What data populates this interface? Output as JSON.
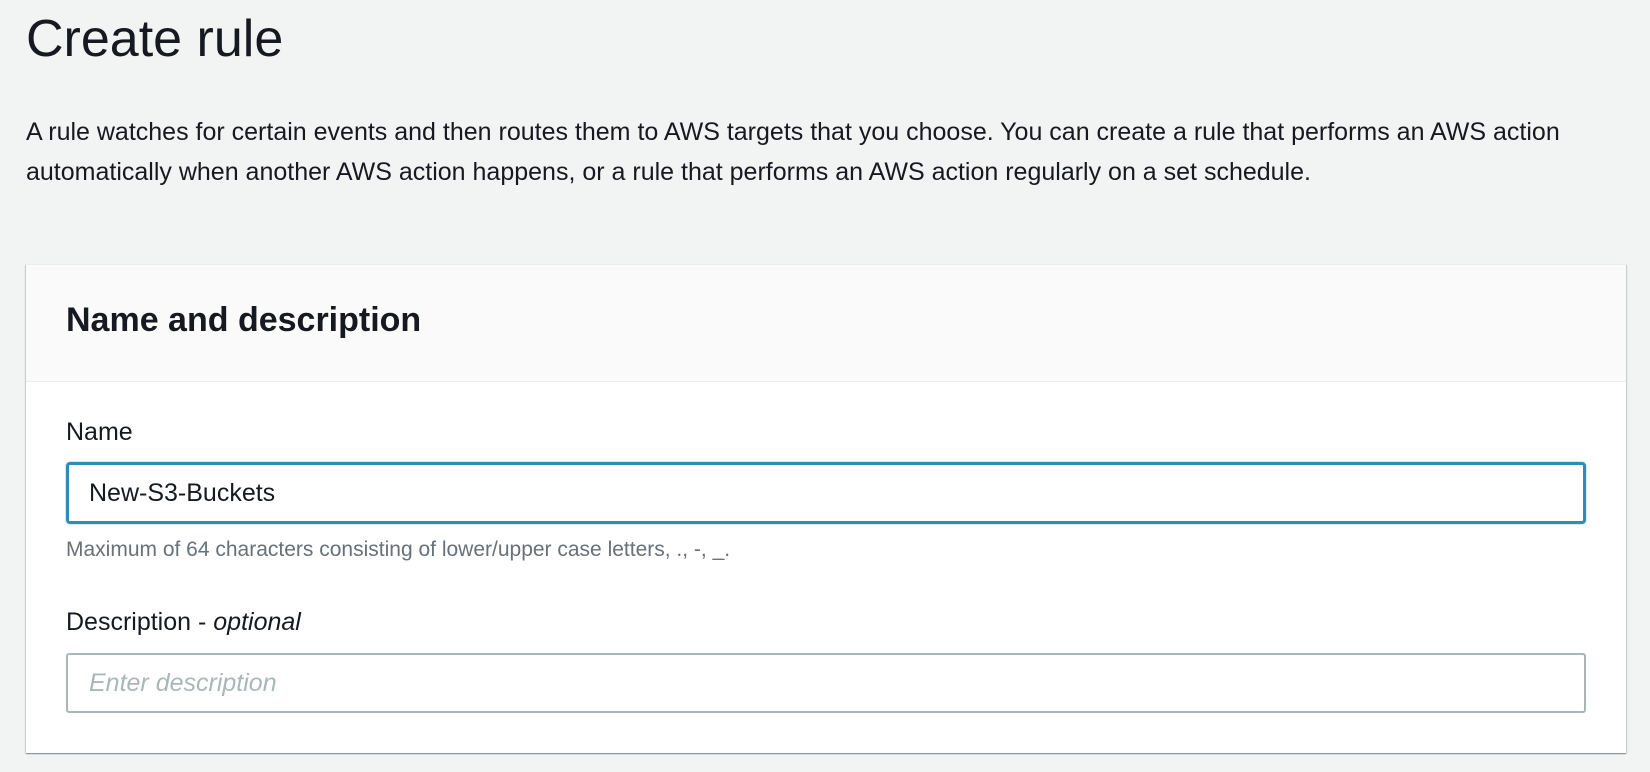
{
  "page": {
    "title": "Create rule",
    "description": "A rule watches for certain events and then routes them to AWS targets that you choose. You can create a rule that performs an AWS action automatically when another AWS action happens, or a rule that performs an AWS action regularly on a set schedule."
  },
  "panel": {
    "title": "Name and description",
    "name_field": {
      "label": "Name",
      "value": "New-S3-Buckets",
      "hint": "Maximum of 64 characters consisting of lower/upper case letters, ., -, _."
    },
    "description_field": {
      "label": "Description - ",
      "label_optional": "optional",
      "value": "",
      "placeholder": "Enter description"
    }
  },
  "colors": {
    "page_background": "#f2f3f3",
    "focus_border": "#2e8db8",
    "input_border": "#aab7b8",
    "hint_text": "#687078"
  }
}
